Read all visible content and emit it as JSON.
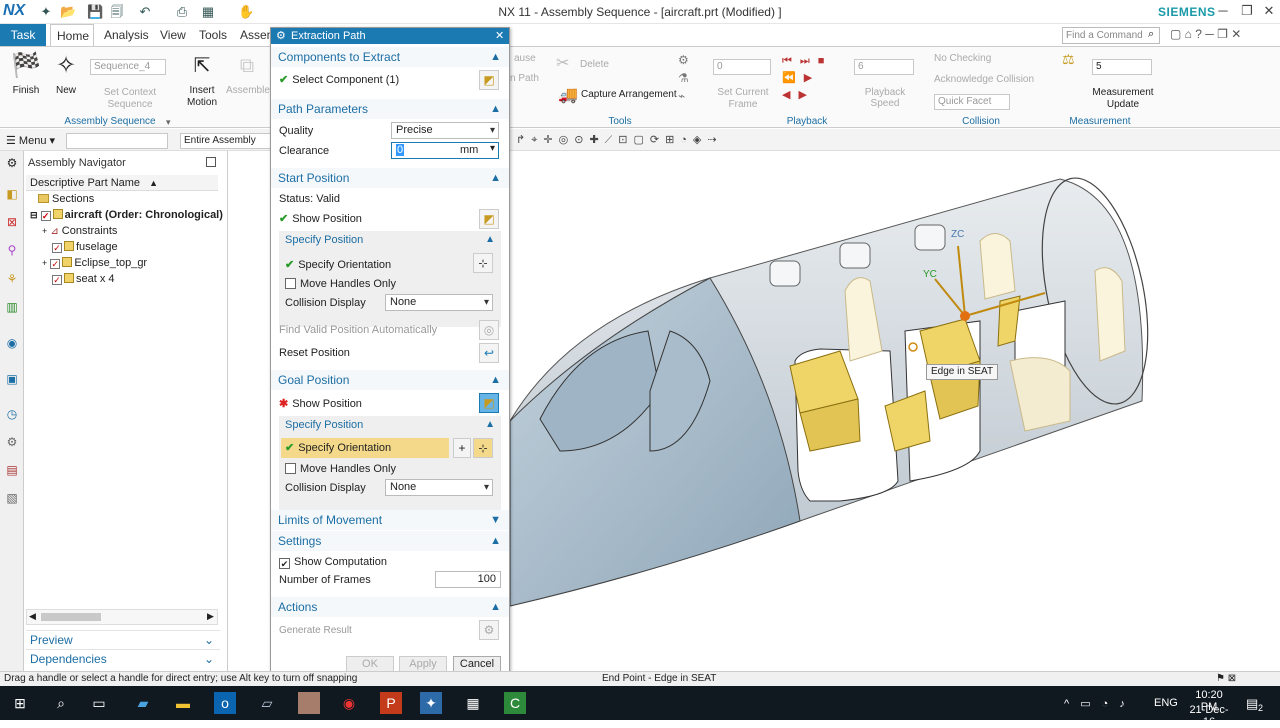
{
  "app": {
    "logo": "NX",
    "title": "NX 11 - Assembly Sequence - [aircraft.prt (Modified) ]",
    "brand": "SIEMENS"
  },
  "tabs": {
    "task": "Task",
    "home": "Home",
    "analysis": "Analysis",
    "view": "View",
    "tools": "Tools",
    "assembly": "Assem"
  },
  "find_command": "Find a Command",
  "ribbon": {
    "finish": "Finish",
    "new": "New",
    "sequence_select": "Sequence_4",
    "set_context": "Set Context Sequence",
    "insert_motion": "Insert Motion",
    "assemble": "Assemble",
    "group_assembly_sequence": "Assembly Sequence",
    "pause": "ause",
    "path": "n Path",
    "delete": "Delete",
    "capture": "Capture Arrangement",
    "group_tools": "Tools",
    "frame_value": "0",
    "set_current_frame": "Set Current Frame",
    "speed_value": "6",
    "playback_speed": "Playback Speed",
    "group_playback": "Playback",
    "no_checking": "No Checking",
    "ack_collision": "Acknowledge Collision",
    "quick_facet": "Quick Facet",
    "group_collision": "Collision",
    "measure_value": "5",
    "measurement_update": "Measurement Update",
    "group_measurement": "Measurement"
  },
  "toolbar2": {
    "menu": "Menu",
    "scope": "Entire Assembly"
  },
  "navigator": {
    "title": "Assembly Navigator",
    "column": "Descriptive Part Name",
    "rows": [
      "Sections",
      "aircraft (Order: Chronological)",
      "Constraints",
      "fuselage",
      "Eclipse_top_gr",
      "seat x 4"
    ],
    "preview": "Preview",
    "dependencies": "Dependencies"
  },
  "dialog": {
    "title": "Extraction Path",
    "components_header": "Components to Extract",
    "select_component": "Select Component (1)",
    "path_header": "Path Parameters",
    "quality_label": "Quality",
    "quality_value": "Precise",
    "clearance_label": "Clearance",
    "clearance_value": "0",
    "clearance_unit": "mm",
    "start_header": "Start Position",
    "status": "Status: Valid",
    "show_position": "Show Position",
    "specify_position": "Specify Position",
    "specify_orientation": "Specify Orientation",
    "move_handles": "Move Handles Only",
    "collision_display": "Collision Display",
    "collision_none": "None",
    "find_valid": "Find Valid Position Automatically",
    "reset_position": "Reset Position",
    "goal_header": "Goal Position",
    "goal_show_position": "Show Position",
    "goal_specify_position": "Specify Position",
    "goal_specify_orientation": "Specify Orientation",
    "goal_move_handles": "Move Handles Only",
    "goal_collision_display": "Collision Display",
    "goal_collision_none": "None",
    "limits_header": "Limits of Movement",
    "settings_header": "Settings",
    "show_computation": "Show Computation",
    "frames_label": "Number of Frames",
    "frames_value": "100",
    "actions_header": "Actions",
    "generate_result": "Generate Result",
    "ok": "OK",
    "apply": "Apply",
    "cancel": "Cancel"
  },
  "viewport": {
    "axis_zc": "ZC",
    "axis_yc": "YC",
    "tooltip": "Edge in SEAT"
  },
  "status": {
    "left": "Drag a handle or select a handle for direct entry; use Alt key to turn off snapping",
    "center": "End Point - Edge in SEAT"
  },
  "taskbar": {
    "lang": "ENG",
    "time": "10:20 PM",
    "date": "21-Dec-16",
    "notify": "2"
  },
  "colors": {
    "accent": "#1c7ab3",
    "seat": "#f1d36a",
    "highlight": "#f5d98a"
  }
}
